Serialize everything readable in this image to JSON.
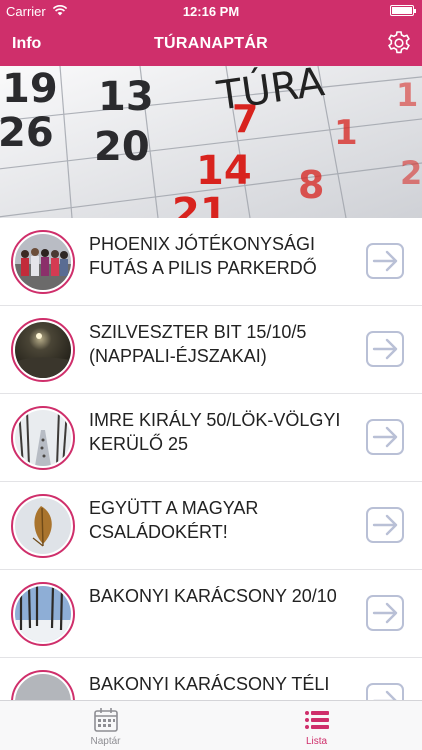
{
  "status_bar": {
    "carrier": "Carrier",
    "time": "12:16 PM",
    "battery_level": 1.0
  },
  "nav": {
    "info_label": "Info",
    "title": "TÚRANAPTÁR",
    "settings_icon": "gear-icon"
  },
  "hero": {
    "calendar_numbers": [
      "19",
      "13",
      "26",
      "20",
      "7",
      "14",
      "21",
      "1",
      "8",
      "1",
      "2"
    ],
    "word": "TÚRA"
  },
  "events": [
    {
      "title": "PHOENIX JÓTÉKONYSÁGI FUTÁS A PILIS PARKERDŐ",
      "photo": "group-of-runners"
    },
    {
      "title": "SZILVESZTER BIT 15/10/5 (NAPPALI-ÉJSZAKAI)",
      "photo": "snowy-night"
    },
    {
      "title": "IMRE KIRÁLY 50/LÖK-VÖLGYI KERÜLŐ 25",
      "photo": "snowy-forest-trail"
    },
    {
      "title": "EGYÜTT A MAGYAR CSALÁDOKÉRT!",
      "photo": "autumn-leaf-in-snow"
    },
    {
      "title": "BAKONYI KARÁCSONY 20/10",
      "photo": "winter-forest"
    },
    {
      "title": "BAKONYI KARÁCSONY TÉLI",
      "photo": "foggy-winter"
    }
  ],
  "tabs": [
    {
      "label": "Naptár",
      "icon": "calendar-icon",
      "active": false
    },
    {
      "label": "Lista",
      "icon": "list-icon",
      "active": true
    }
  ],
  "colors": {
    "brand": "#cf2f6b",
    "arrow_border": "#b9c0d6",
    "inactive_tab": "#8e8e93"
  }
}
